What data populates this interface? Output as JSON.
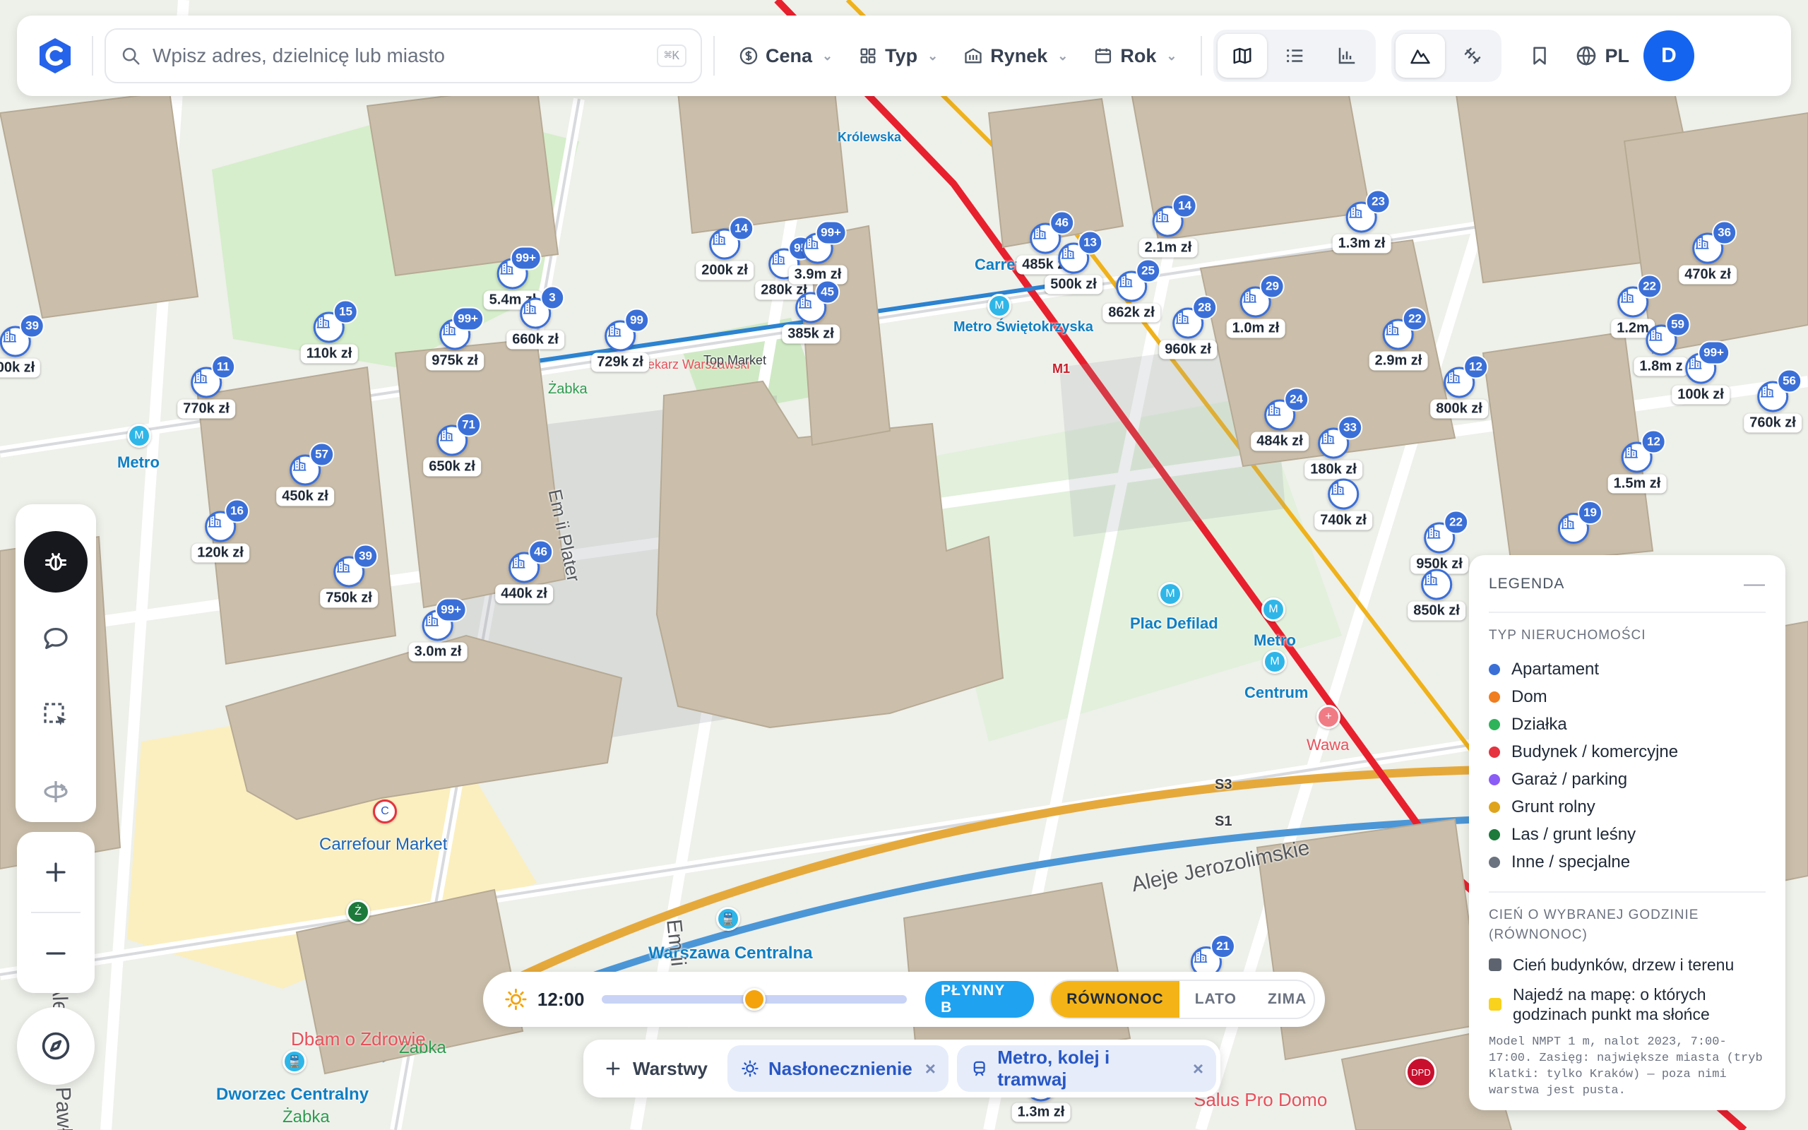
{
  "search": {
    "placeholder": "Wpisz adres, dzielnicę lub miasto",
    "shortcut": "⌘K"
  },
  "filters": [
    {
      "label": "Cena",
      "icon": "dollar-circle-icon"
    },
    {
      "label": "Typ",
      "icon": "grid-icon"
    },
    {
      "label": "Rynek",
      "icon": "building-icon"
    },
    {
      "label": "Rok",
      "icon": "calendar-icon"
    }
  ],
  "view_modes": [
    "map-icon",
    "list-icon",
    "chart-icon"
  ],
  "header": {
    "language": "PL",
    "avatar_initial": "D"
  },
  "map_labels": {
    "carrefour_market": "Carrefour Market",
    "plac_defilad": "Plac Defilad",
    "metro": "Metro",
    "centrum": "Centrum",
    "wawa": "Wawa",
    "warszawa_centralna": "Warszawa Centralna",
    "dworzec_centralny": "Dworzec Centralny",
    "krolewska": "Królewska",
    "metro_swietokrzyska": "Metro Świętokrzyska",
    "aleje_jerozolimskie": "Aleje Jerozolimskie",
    "aleja_jana_pawla_ii": "Aleja Jana Pawła II",
    "em_ii_plater": "Em ii Plater",
    "zabka": "Żabka",
    "dbam_o_zdrowie": "Dbam o Zdrowie",
    "salus_pro_domo": "Salus Pro Domo",
    "s3": "S3",
    "s1": "S1",
    "m1": "M1",
    "apteka": "Aptekarz Warszawski",
    "top_market": "Top Market",
    "zabka2": "Żabka",
    "carrefour": "Carrefour",
    "metro_onz": "Metro",
    "dpd": "DPD"
  },
  "markers": [
    {
      "count": "39",
      "price": "00k zł"
    },
    {
      "count": "11",
      "price": "770k zł"
    },
    {
      "count": "15",
      "price": "110k zł"
    },
    {
      "count": "99+",
      "price": "975k zł"
    },
    {
      "count": "99+",
      "price": "5.4m zł"
    },
    {
      "count": "3",
      "price": "660k zł"
    },
    {
      "count": "99",
      "price": "729k zł"
    },
    {
      "count": "14",
      "price": "200k zł"
    },
    {
      "count": "95",
      "price": "280k zł"
    },
    {
      "count": "99+",
      "price": "3.9m zł"
    },
    {
      "count": "45",
      "price": "385k zł"
    },
    {
      "count": "46",
      "price": "485k zł"
    },
    {
      "count": "13",
      "price": "500k zł"
    },
    {
      "count": "14",
      "price": "2.1m zł"
    },
    {
      "count": "25",
      "price": "862k zł"
    },
    {
      "count": "28",
      "price": "960k zł"
    },
    {
      "count": "29",
      "price": "1.0m zł"
    },
    {
      "count": "23",
      "price": "1.3m zł"
    },
    {
      "count": "22",
      "price": "2.9m zł"
    },
    {
      "count": "12",
      "price": "800k zł"
    },
    {
      "count": "36",
      "price": "470k zł"
    },
    {
      "count": "22",
      "price": "1.2m"
    },
    {
      "count": "59",
      "price": "1.8m z"
    },
    {
      "count": "99+",
      "price": "100k zł"
    },
    {
      "count": "56",
      "price": "760k zł"
    },
    {
      "count": "24",
      "price": "484k zł"
    },
    {
      "count": "33",
      "price": "180k zł"
    },
    {
      "count": "",
      "price": "740k zł"
    },
    {
      "count": "12",
      "price": "1.5m zł"
    },
    {
      "count": "71",
      "price": "650k zł"
    },
    {
      "count": "57",
      "price": "450k zł"
    },
    {
      "count": "16",
      "price": "120k zł"
    },
    {
      "count": "39",
      "price": "750k zł"
    },
    {
      "count": "46",
      "price": "440k zł"
    },
    {
      "count": "99+",
      "price": "3.0m zł"
    },
    {
      "count": "22",
      "price": "950k zł"
    },
    {
      "count": "",
      "price": "850k zł"
    },
    {
      "count": "19",
      "price": ""
    },
    {
      "count": "21",
      "price": ""
    },
    {
      "count": "",
      "price": "1.3m zł"
    }
  ],
  "legend": {
    "title": "LEGENDA",
    "collapse": "—",
    "section_type": "TYP NIERUCHOMOŚCI",
    "types": [
      {
        "label": "Apartament",
        "color": "#3b6fd8"
      },
      {
        "label": "Dom",
        "color": "#f07d1f"
      },
      {
        "label": "Działka",
        "color": "#2fb35a"
      },
      {
        "label": "Budynek / komercyjne",
        "color": "#e5333f"
      },
      {
        "label": "Garaż / parking",
        "color": "#8b5cf6"
      },
      {
        "label": "Grunt rolny",
        "color": "#e0a41c"
      },
      {
        "label": "Las / grunt leśny",
        "color": "#1d7a3b"
      },
      {
        "label": "Inne / specjalne",
        "color": "#6b7280"
      }
    ],
    "section_shadow": "CIEŃ O WYBRANEJ GODZINIE (RÓWNONOC)",
    "shadow_item": "Cień budynków, drzew i terenu",
    "sun_item": "Najedź na mapę: o których godzinach punkt ma słońce",
    "note": "Model NMPT 1 m, nalot 2023, 7:00-17:00. Zasięg: największe miasta (tryb Klatki: tylko Kraków) — poza nimi warstwa jest pusta."
  },
  "timebar": {
    "time": "12:00",
    "time_progress": 0.5,
    "play_label": "PŁYNNY B",
    "seasons": [
      "RÓWNONOC",
      "LATO",
      "ZIMA"
    ],
    "active_season": "RÓWNONOC"
  },
  "layers": {
    "add_label": "Warstwy",
    "chips": [
      {
        "label": "Nasłonecznienie",
        "icon": "sun-icon"
      },
      {
        "label": "Metro, kolej i tramwaj",
        "icon": "tram-icon"
      }
    ]
  },
  "colors": {
    "accent": "#1464f0",
    "marker": "#3b6fd8",
    "metro_line": "#e8202e",
    "sun": "#f4a30c"
  }
}
